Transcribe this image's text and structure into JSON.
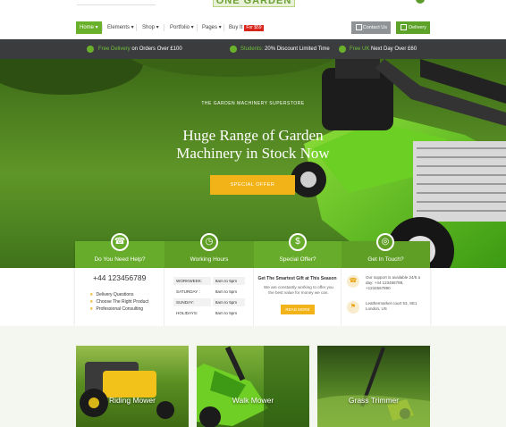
{
  "brand": {
    "logo_text": "ONE GARDEN"
  },
  "nav": {
    "items": [
      {
        "label": "Home ▾",
        "active": true
      },
      {
        "label": "Elements ▾",
        "active": false
      },
      {
        "label": "Shop ▾",
        "active": false
      },
      {
        "label": "Portfolio ▾",
        "active": false
      },
      {
        "label": "Pages ▾",
        "active": false
      },
      {
        "label": "Buy It",
        "active": false
      }
    ],
    "buy_badge": "For $59",
    "contact_label": "Contact Us",
    "delivery_label": "Delivery"
  },
  "promo_bar": {
    "item1_highlight": "Free Delivery",
    "item1_rest": " on Orders Over £100",
    "item2_highlight": "Students:",
    "item2_rest": " 20% Discount Limited Time",
    "item3_highlight": "Free UK",
    "item3_rest": " Next Day Over £60"
  },
  "hero": {
    "kicker": "THE GARDEN MACHINERY SUPERSTORE",
    "title_line1": "Huge Range of Garden",
    "title_line2": "Machinery in Stock Now",
    "button": "SPECIAL OFFER"
  },
  "cards": {
    "help": {
      "title": "Do You Need Help?",
      "phone": "+44 123456789",
      "items": [
        "Delivery Questions",
        "Choose The Right Product",
        "Professional Consulting"
      ]
    },
    "hours": {
      "title": "Working Hours",
      "rows": [
        {
          "day": "WORKWEEK:",
          "time": "8am to 5pm"
        },
        {
          "day": "SATURDAY :",
          "time": "8am to 5pm"
        },
        {
          "day": "SUNDAY:",
          "time": "8am to 5pm"
        },
        {
          "day": "HOLIDAYS:",
          "time": "8am to 5pm"
        }
      ]
    },
    "offer": {
      "title": "Special Offer?",
      "heading": "Get The Smartest Gift at This Season",
      "text": "We are constantly working to offer you the best value for money we can.",
      "button": "READ MORE"
    },
    "touch": {
      "title": "Get In Touch?",
      "support": "Our support is available 24/5 a day: +44 123456789, +1234567890",
      "address": "Leathermarket court 53, SE1 London, US"
    }
  },
  "products": [
    {
      "title": "Riding Mower"
    },
    {
      "title": "Walk Mower"
    },
    {
      "title": "Grass Trimmer"
    }
  ],
  "colors": {
    "green": "#68ac2b",
    "yellow": "#f2b318",
    "dark_bar": "#3b3c3e"
  }
}
